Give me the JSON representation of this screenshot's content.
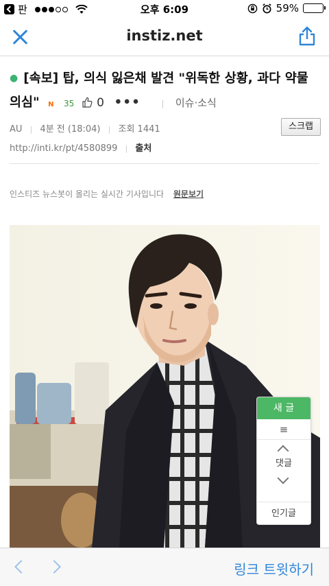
{
  "status_bar": {
    "back_app": "판",
    "time": "오후 6:09",
    "battery": "59%",
    "battery_level": 0.59
  },
  "navbar": {
    "title": "instiz.net"
  },
  "article": {
    "title": "[속보] 탑, 의식 잃은채 발견 \"위독한 상황, 과다 약물 의심\"",
    "new_badge": "N",
    "likes": "35",
    "thumb_count": "0",
    "more": "•••",
    "category": "이슈·소식",
    "author": "AU",
    "time_ago": "4분 전 (18:04)",
    "views": "조회 1441",
    "scrap_label": "스크랩",
    "url": "http://inti.kr/pt/4580899",
    "source_label": "출처",
    "notice": "인스티즈 뉴스봇이 올리는 실시간 기사입니다",
    "original_link": "원문보기"
  },
  "side_panel": {
    "new_post": "새 글",
    "menu": "≡",
    "comments": "댓글",
    "popular": "인기글"
  },
  "bottom_bar": {
    "tweet_link": "링크 트윗하기"
  },
  "colors": {
    "accent": "#2f86d8",
    "green": "#4cb764"
  }
}
